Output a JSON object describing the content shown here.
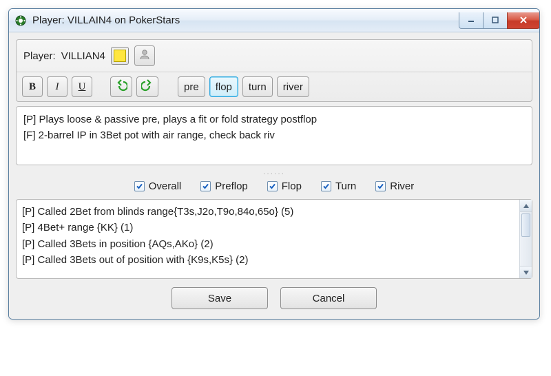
{
  "window": {
    "title": "Player: VILLAIN4 on PokerStars"
  },
  "player": {
    "label": "Player:",
    "name": "VILLIAN4",
    "color": "#ffe640"
  },
  "toolbar": {
    "bold": "B",
    "italic": "I",
    "underline": "U",
    "streets": [
      {
        "key": "pre",
        "label": "pre",
        "active": false
      },
      {
        "key": "flop",
        "label": "flop",
        "active": true
      },
      {
        "key": "turn",
        "label": "turn",
        "active": false
      },
      {
        "key": "river",
        "label": "river",
        "active": false
      }
    ]
  },
  "notes": [
    "[P] Plays loose & passive pre, plays a fit or fold strategy postflop",
    "[F] 2-barrel IP in 3Bet pot with air range, check back riv"
  ],
  "filters": [
    {
      "key": "overall",
      "label": "Overall",
      "checked": true
    },
    {
      "key": "preflop",
      "label": "Preflop",
      "checked": true
    },
    {
      "key": "flop",
      "label": "Flop",
      "checked": true
    },
    {
      "key": "turn",
      "label": "Turn",
      "checked": true
    },
    {
      "key": "river",
      "label": "River",
      "checked": true
    }
  ],
  "autonotes": [
    "[P] Called 2Bet from blinds range{T3s,J2o,T9o,84o,65o} (5)",
    "[P] 4Bet+ range {KK} (1)",
    "[P] Called 3Bets in position {AQs,AKo} (2)",
    "[P] Called 3Bets out of position with {K9s,K5s} (2)"
  ],
  "footer": {
    "save": "Save",
    "cancel": "Cancel"
  }
}
